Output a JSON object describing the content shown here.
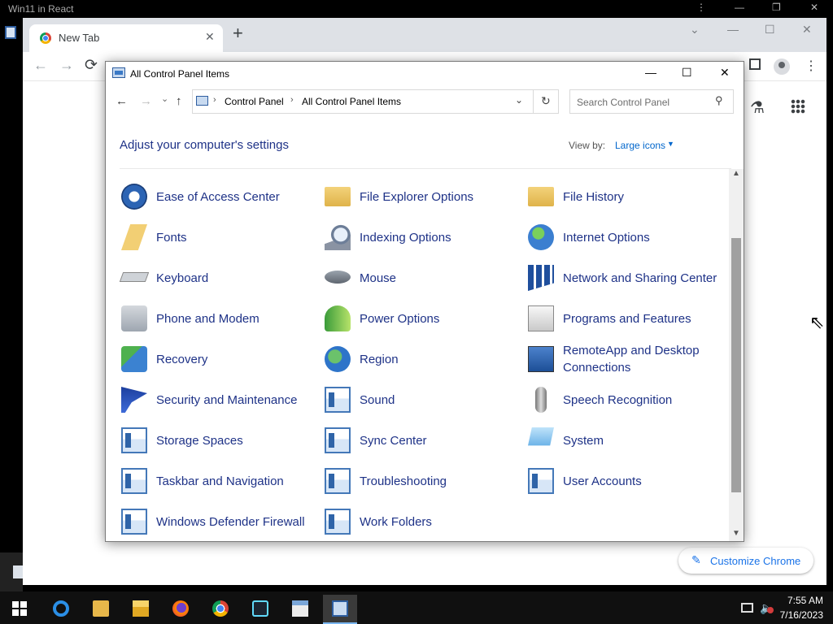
{
  "host": {
    "title": "Win11 in React",
    "menu_icon": "⋮",
    "min_icon": "—",
    "restore_icon": "❐",
    "close_icon": "✕"
  },
  "chrome": {
    "tab_title": "New Tab",
    "tab_close": "✕",
    "new_tab": "+",
    "back": "←",
    "forward": "→",
    "reload": "⟳",
    "menu": "⋮",
    "collapse_icon": "⌄",
    "min_icon": "—",
    "max_icon": "☐",
    "close_icon": "✕",
    "labs_icon": "⚗",
    "customize_label": "Customize Chrome",
    "customize_icon": "✎"
  },
  "control_panel": {
    "title": "All Control Panel Items",
    "min_icon": "—",
    "max_icon": "☐",
    "close_icon": "✕",
    "nav": {
      "back": "←",
      "forward": "→",
      "recent": "⌄",
      "up": "↑"
    },
    "breadcrumb": [
      "Control Panel",
      "All Control Panel Items"
    ],
    "crumb_sep": "›",
    "address_dropdown": "⌄",
    "refresh": "↻",
    "search_placeholder": "Search Control Panel",
    "search_icon": "⚲",
    "heading": "Adjust your computer's settings",
    "view_by_label": "View by:",
    "view_by_value": "Large icons",
    "view_by_caret": "▼",
    "scroll_up": "▲",
    "scroll_down": "▼",
    "scroll_position": 0.6,
    "items": [
      {
        "label": "Ease of Access Center",
        "icon": "ease-of-access"
      },
      {
        "label": "File Explorer Options",
        "icon": "folder-options"
      },
      {
        "label": "File History",
        "icon": "file-history"
      },
      {
        "label": "Fonts",
        "icon": "fonts"
      },
      {
        "label": "Indexing Options",
        "icon": "indexing"
      },
      {
        "label": "Internet Options",
        "icon": "internet"
      },
      {
        "label": "Keyboard",
        "icon": "keyboard"
      },
      {
        "label": "Mouse",
        "icon": "mouse"
      },
      {
        "label": "Network and Sharing Center",
        "icon": "network"
      },
      {
        "label": "Phone and Modem",
        "icon": "phone"
      },
      {
        "label": "Power Options",
        "icon": "power"
      },
      {
        "label": "Programs and Features",
        "icon": "programs"
      },
      {
        "label": "Recovery",
        "icon": "recovery"
      },
      {
        "label": "Region",
        "icon": "region"
      },
      {
        "label": "RemoteApp and Desktop Connections",
        "icon": "remote"
      },
      {
        "label": "Security and Maintenance",
        "icon": "security"
      },
      {
        "label": "Sound",
        "icon": "sound"
      },
      {
        "label": "Speech Recognition",
        "icon": "microphone"
      },
      {
        "label": "Storage Spaces",
        "icon": "storage"
      },
      {
        "label": "Sync Center",
        "icon": "sync"
      },
      {
        "label": "System",
        "icon": "system"
      },
      {
        "label": "Taskbar and Navigation",
        "icon": "taskbar"
      },
      {
        "label": "Troubleshooting",
        "icon": "troubleshooting"
      },
      {
        "label": "User Accounts",
        "icon": "user-accounts"
      },
      {
        "label": "Windows Defender Firewall",
        "icon": "firewall"
      },
      {
        "label": "Work Folders",
        "icon": "work-folders"
      }
    ]
  },
  "taskbar": {
    "apps": [
      "start",
      "internet-explorer",
      "media-player",
      "file-explorer",
      "firefox",
      "chrome",
      "react",
      "terminal",
      "control-panel"
    ],
    "active": "control-panel",
    "volume_icon": "🔈",
    "time": "7:55 AM",
    "date": "7/16/2023"
  }
}
